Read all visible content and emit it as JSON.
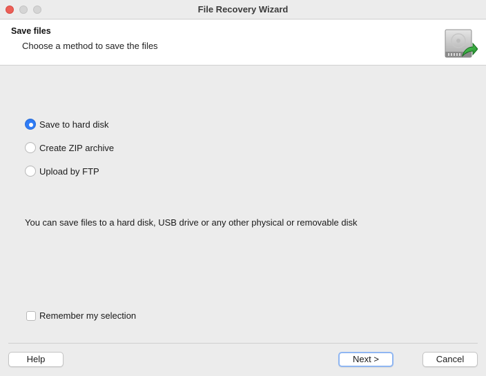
{
  "window": {
    "title": "File Recovery Wizard"
  },
  "header": {
    "title": "Save files",
    "subtitle": "Choose a method to save the files",
    "icon": "hard-drive-save-icon"
  },
  "options": {
    "items": [
      {
        "label": "Save to hard disk",
        "selected": true
      },
      {
        "label": "Create ZIP archive",
        "selected": false
      },
      {
        "label": "Upload by FTP",
        "selected": false
      }
    ]
  },
  "description": "You can save files to a hard disk, USB drive or any other physical or removable disk",
  "remember": {
    "label": "Remember my selection",
    "checked": false
  },
  "buttons": {
    "help": "Help",
    "next": "Next >",
    "cancel": "Cancel"
  },
  "colors": {
    "accent": "#2f7cf6",
    "close": "#ec5f57",
    "arrow": "#2eaa3c"
  }
}
